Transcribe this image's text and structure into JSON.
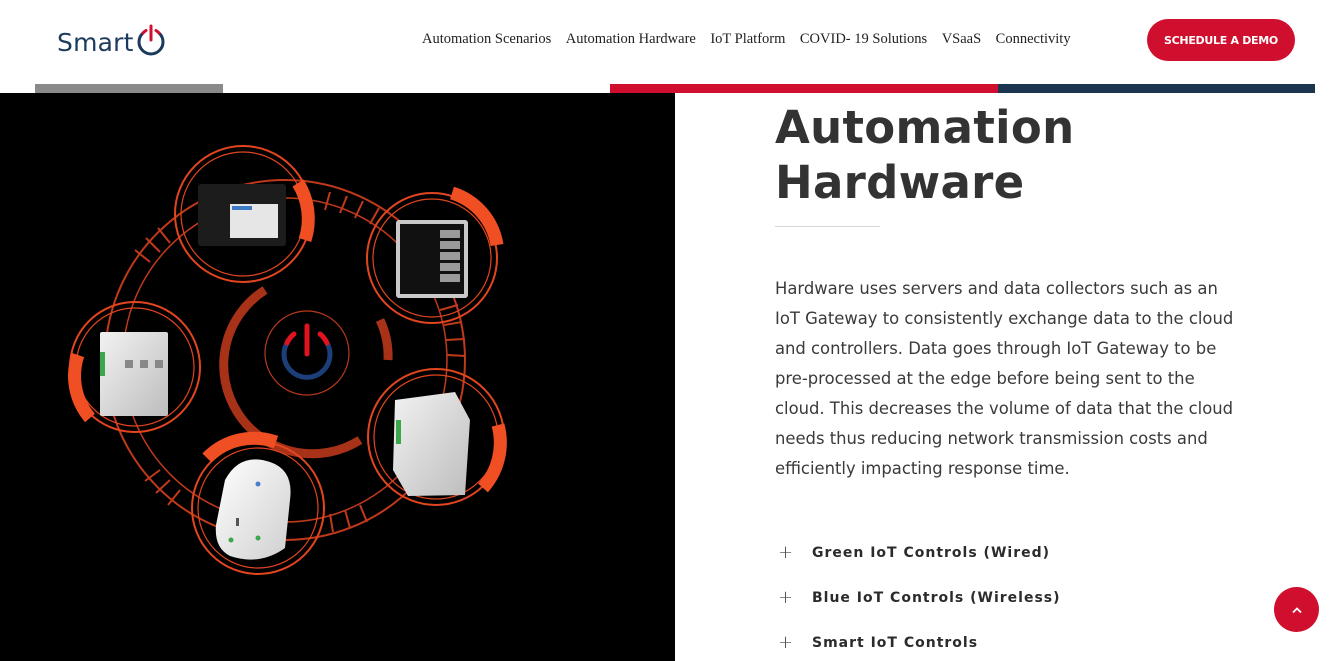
{
  "header": {
    "logo_text": "Smart",
    "logo_icon": "power-icon",
    "nav": [
      {
        "label": "Automation Scenarios"
      },
      {
        "label": "Automation Hardware"
      },
      {
        "label": "IoT Platform"
      },
      {
        "label": "COVID- 19 Solutions"
      },
      {
        "label": "VSaaS"
      },
      {
        "label": "Connectivity"
      }
    ],
    "cta_label": "SCHEDULE A DEMO"
  },
  "colors": {
    "brand_red": "#d00f2e",
    "brand_navy": "#1b3450",
    "accent_orange": "#f04e23",
    "bar_gray": "#8a8a8a"
  },
  "hero": {
    "image_alt": "Automation hardware devices arranged around a power icon",
    "devices": [
      "gateway-box",
      "touch-panel",
      "din-rail-module-left",
      "din-rail-module-right",
      "smart-plug"
    ]
  },
  "main": {
    "title_line1": "Automation",
    "title_line2": "Hardware",
    "description": "Hardware uses servers and data collectors such as an IoT Gateway to consistently exchange data to the cloud and controllers. Data goes through IoT Gateway to be pre-processed at the edge before being sent to the cloud. This decreases the volume of data that the cloud needs thus reducing network transmission costs and efficiently impacting response time."
  },
  "accordion": [
    {
      "icon": "plus-icon",
      "label": "Green IoT Controls (Wired)"
    },
    {
      "icon": "plus-icon",
      "label": "Blue IoT Controls (Wireless)"
    },
    {
      "icon": "plus-icon",
      "label": "Smart IoT Controls"
    }
  ],
  "scroll_top": {
    "icon": "chevron-up-icon"
  }
}
